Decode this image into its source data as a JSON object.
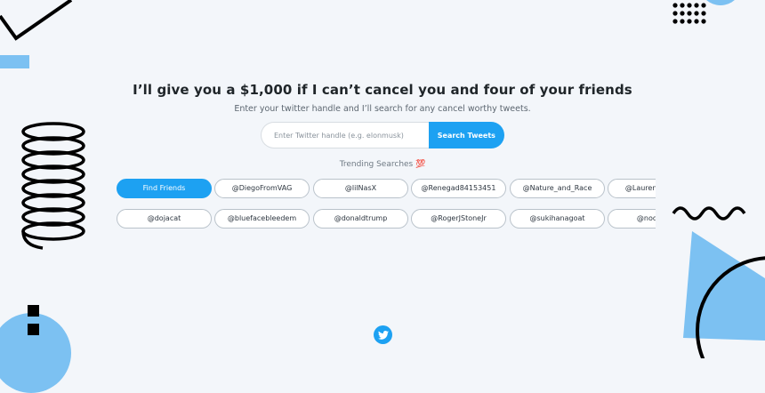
{
  "hero": {
    "headline": "I’ll give you a $1,000 if I can’t cancel you and four of your friends",
    "subline": "Enter your twitter handle and I’ll search for any cancel worthy tweets."
  },
  "search": {
    "placeholder": "Enter Twitter handle (e.g. elonmusk)",
    "value": "",
    "button_label": "Search Tweets"
  },
  "trending": {
    "label": "Trending Searches 💯",
    "row1": [
      {
        "label": "Find Friends",
        "primary": true
      },
      {
        "label": "@DiegoFromVAG"
      },
      {
        "label": "@lilNasX"
      },
      {
        "label": "@Renegad84153451"
      },
      {
        "label": "@Nature_and_Race"
      },
      {
        "label": "@LaurenBoebert"
      }
    ],
    "row2": [
      {
        "label": "@dojacat"
      },
      {
        "label": "@bluefacebleedem"
      },
      {
        "label": "@donaldtrump"
      },
      {
        "label": "@RogerJStoneJr"
      },
      {
        "label": "@sukihanagoat"
      },
      {
        "label": "@nodoubt"
      }
    ]
  },
  "footer": {
    "icon": "twitter-bird-icon"
  },
  "colors": {
    "accent": "#1da1f2",
    "background": "#f3f6fa",
    "decor_blue": "#7cc1f2",
    "decor_dark": "#000000"
  }
}
